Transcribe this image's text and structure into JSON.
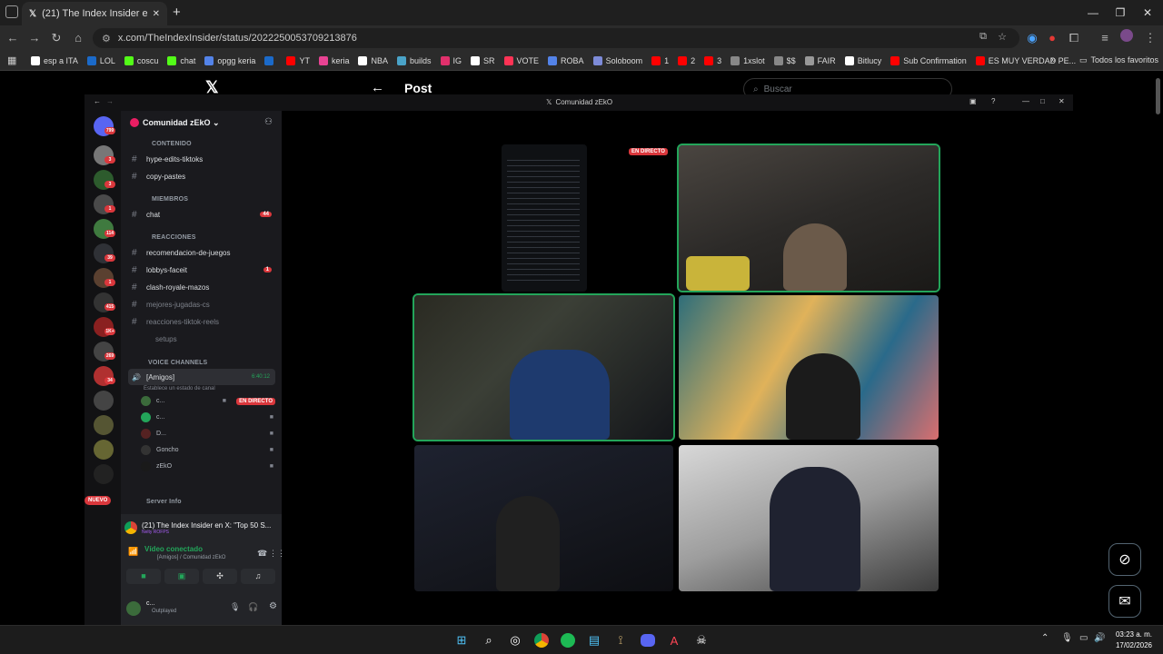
{
  "browser": {
    "tab_title": "(21) The Index Insider en X: \"To",
    "new_tab": "+",
    "url": "x.com/TheIndexInsider/status/2022250053709213876",
    "window_min": "—",
    "window_max": "❐",
    "window_close": "✕"
  },
  "bookmarks": [
    {
      "label": "esp a ITA",
      "color": "#ffffff"
    },
    {
      "label": "LOL",
      "color": "#1b6ac9"
    },
    {
      "label": "coscu",
      "color": "#53fc18"
    },
    {
      "label": "chat",
      "color": "#53fc18"
    },
    {
      "label": "opgg keria",
      "color": "#5383e8"
    },
    {
      "label": "",
      "color": "#1b6ac9"
    },
    {
      "label": "YT",
      "color": "#ff0000"
    },
    {
      "label": "keria",
      "color": "#e84393"
    },
    {
      "label": "NBA",
      "color": "#ffffff"
    },
    {
      "label": "builds",
      "color": "#4aa3c8"
    },
    {
      "label": "IG",
      "color": "#e1306c"
    },
    {
      "label": "SR",
      "color": "#ffffff"
    },
    {
      "label": "VOTE",
      "color": "#ff3355"
    },
    {
      "label": "ROBA",
      "color": "#5383e8"
    },
    {
      "label": "Soloboom",
      "color": "#7d8bd8"
    },
    {
      "label": "1",
      "color": "#ff0000"
    },
    {
      "label": "2",
      "color": "#ff0000"
    },
    {
      "label": "3",
      "color": "#ff0000"
    },
    {
      "label": "1xslot",
      "color": "#888888"
    },
    {
      "label": "$$",
      "color": "#888888"
    },
    {
      "label": "FAIR",
      "color": "#999999"
    },
    {
      "label": "Bitlucy",
      "color": "#ffffff"
    },
    {
      "label": "Sub Confirmation",
      "color": "#ff0000"
    },
    {
      "label": "ES MUY VERDAD PE...",
      "color": "#ff0000"
    }
  ],
  "bookmarks_more": "»",
  "bookmarks_all": "Todos los favoritos",
  "x": {
    "logo": "𝕏",
    "post_title": "Post",
    "search_placeholder": "Buscar"
  },
  "discord": {
    "window_title": "Comunidad zEkO",
    "server_name": "Comunidad zEkO",
    "guild_badges": [
      "799",
      "3",
      "3",
      "1",
      "114",
      "39",
      "1",
      "415",
      "1K+",
      "269",
      "34"
    ],
    "categories": {
      "contenido": "CONTENIDO",
      "miembros": "MIEMBROS",
      "reacciones": "REACCIONES",
      "voice": "VOICE CHANNELS",
      "server_info": "Server Info"
    },
    "channels": [
      {
        "name": "hype-edits-tiktoks",
        "badge": ""
      },
      {
        "name": "copy-pastes",
        "badge": ""
      },
      {
        "name": "chat",
        "badge": "44"
      },
      {
        "name": "recomendacion-de-juegos",
        "badge": ""
      },
      {
        "name": "lobbys-faceit",
        "badge": "1"
      },
      {
        "name": "clash-royale-mazos",
        "badge": ""
      },
      {
        "name": "mejores-jugadas-cs",
        "badge": ""
      },
      {
        "name": "reacciones-tiktok-reels",
        "badge": ""
      },
      {
        "name": "setups",
        "badge": ""
      }
    ],
    "voice_channel": {
      "name": "[Amigos]",
      "timer": "6:40:12",
      "status_hint": "Establece un estado de canal",
      "users": [
        {
          "name": "c...",
          "live": "EN DIRECTO"
        },
        {
          "name": "c...",
          "live": ""
        },
        {
          "name": "D...",
          "live": ""
        },
        {
          "name": "Goncho",
          "live": ""
        },
        {
          "name": "zEkO",
          "live": ""
        }
      ]
    },
    "new_badge": "NUEVO",
    "activity": {
      "title": "(21) The Index Insider en X: \"Top 50 S...",
      "subtitle": "Nelty ROFPS"
    },
    "connection": {
      "status": "Vídeo conectado",
      "channel": "[Amigos] / Comunidad zEkO"
    },
    "user": {
      "name": "c...",
      "status": "Outplayed"
    },
    "stage": {
      "live_label": "EN DIRECTO"
    }
  },
  "taskbar": {
    "time": "03:23 a. m.",
    "date": "17/02/2026"
  }
}
